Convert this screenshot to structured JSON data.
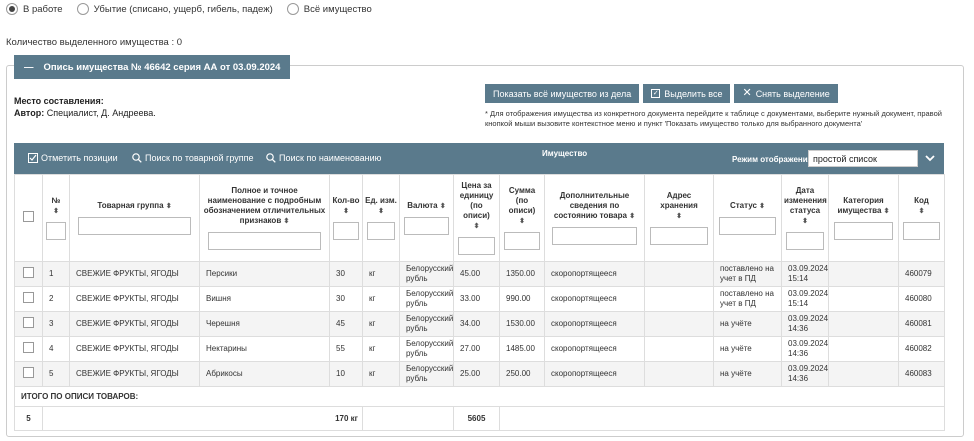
{
  "filters": [
    {
      "label": "В работе",
      "checked": true
    },
    {
      "label": "Убытие (списано, ущерб, гибель, падеж)",
      "checked": false
    },
    {
      "label": "Всё имущество",
      "checked": false
    }
  ],
  "selected_count": "Количество выделенного имущества : 0",
  "panel": {
    "collapse_symbol": "—",
    "title": "Опись имущества № 46642 серия АА от 03.09.2024",
    "place_label": "Место составления:",
    "author_label": "Автор:",
    "author_value": " Специалист, Д. Андреева."
  },
  "buttons": {
    "show_all": "Показать всё имущество из дела",
    "select_all": "Выделить все",
    "deselect": "Снять выделение"
  },
  "note": "* Для отображения имущества из конкретного документа перейдите к таблице с документами, выберите нужный документ, правой кнопкой мыши вызовите контекстное меню и пункт 'Показать имущество только для выбранного документа'",
  "toolbar": {
    "mark": "Отметить позиции",
    "search_group": "Поиск по товарной группе",
    "search_name": "Поиск по наименованию",
    "section": "Имущество",
    "mode_label": "Режим отображения",
    "mode_value": "простой список"
  },
  "columns": {
    "num": "№",
    "group": "Товарная группа",
    "name": "Полное и точное наименование с подробным обозначением отличительных признаков",
    "qty": "Кол-во",
    "unit": "Ед. изм.",
    "currency": "Валюта",
    "price": "Цена за единицу (по описи)",
    "sum": "Сумма (по описи)",
    "extra": "Дополнительные сведения по состоянию товара",
    "storage": "Адрес хранения",
    "status": "Статус",
    "date": "Дата изменения статуса",
    "category": "Категория имущества",
    "code": "Код"
  },
  "rows": [
    {
      "num": "1",
      "group": "СВЕЖИЕ ФРУКТЫ, ЯГОДЫ",
      "name": "Персики",
      "qty": "30",
      "unit": "кг",
      "currency": "Белорусский рубль",
      "price": "45.00",
      "sum": "1350.00",
      "extra": "скоропортящееся",
      "storage": "",
      "status": "поставлено на учет в ПД",
      "date": "03.09.2024 15:14",
      "category": "",
      "code": "460079"
    },
    {
      "num": "2",
      "group": "СВЕЖИЕ ФРУКТЫ, ЯГОДЫ",
      "name": "Вишня",
      "qty": "30",
      "unit": "кг",
      "currency": "Белорусский рубль",
      "price": "33.00",
      "sum": "990.00",
      "extra": "скоропортящееся",
      "storage": "",
      "status": "поставлено на учет в ПД",
      "date": "03.09.2024 15:14",
      "category": "",
      "code": "460080"
    },
    {
      "num": "3",
      "group": "СВЕЖИЕ ФРУКТЫ, ЯГОДЫ",
      "name": "Черешня",
      "qty": "45",
      "unit": "кг",
      "currency": "Белорусский рубль",
      "price": "34.00",
      "sum": "1530.00",
      "extra": "скоропортящееся",
      "storage": "",
      "status": "на учёте",
      "date": "03.09.2024 14:36",
      "category": "",
      "code": "460081"
    },
    {
      "num": "4",
      "group": "СВЕЖИЕ ФРУКТЫ, ЯГОДЫ",
      "name": "Нектарины",
      "qty": "55",
      "unit": "кг",
      "currency": "Белорусский рубль",
      "price": "27.00",
      "sum": "1485.00",
      "extra": "скоропортящееся",
      "storage": "",
      "status": "на учёте",
      "date": "03.09.2024 14:36",
      "category": "",
      "code": "460082"
    },
    {
      "num": "5",
      "group": "СВЕЖИЕ ФРУКТЫ, ЯГОДЫ",
      "name": "Абрикосы",
      "qty": "10",
      "unit": "кг",
      "currency": "Белорусский рубль",
      "price": "25.00",
      "sum": "250.00",
      "extra": "скоропортящееся",
      "storage": "",
      "status": "на учёте",
      "date": "03.09.2024 14:36",
      "category": "",
      "code": "460083"
    }
  ],
  "totals": {
    "label": "ИТОГО ПО ОПИСИ ТОВАРОВ:",
    "count": "5",
    "qty": "170 кг",
    "sum": "5605"
  },
  "colors": {
    "accent": "#5a7a8c"
  }
}
